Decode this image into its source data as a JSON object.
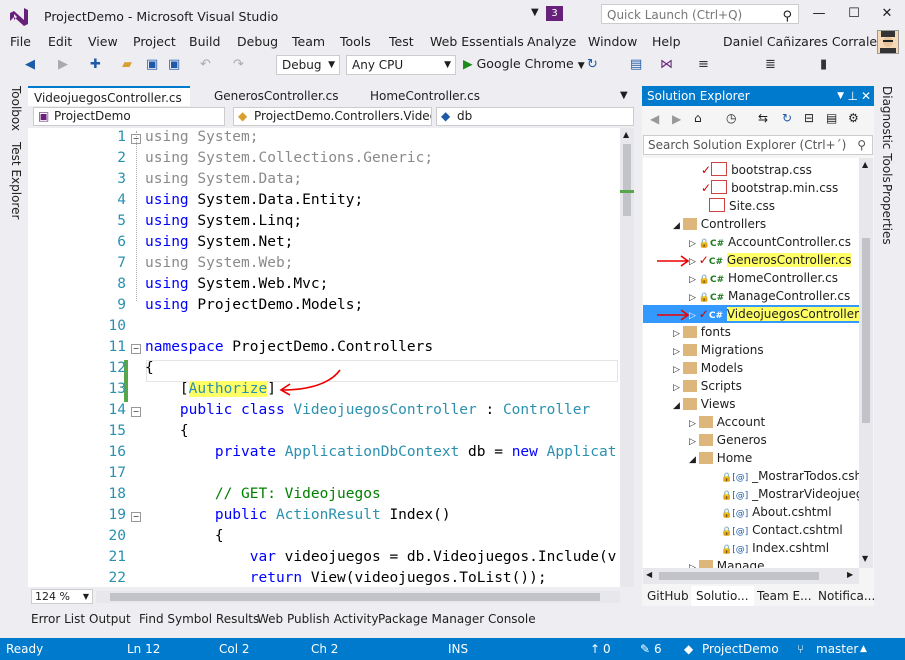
{
  "window": {
    "title": "ProjectDemo - Microsoft Visual Studio",
    "notification_count": "3",
    "quick_launch_placeholder": "Quick Launch (Ctrl+Q)",
    "user": "Daniel Cañizares Corrales"
  },
  "menu": [
    "File",
    "Edit",
    "View",
    "Project",
    "Build",
    "Debug",
    "Team",
    "Tools",
    "Test",
    "Web Essentials",
    "Analyze",
    "Window",
    "Help"
  ],
  "toolbar": {
    "config": "Debug",
    "platform": "Any CPU",
    "run_target": "Google Chrome"
  },
  "side_tabs_left": [
    "Toolbox",
    "Test Explorer"
  ],
  "side_tabs_right": [
    "Diagnostic Tools",
    "Properties"
  ],
  "doc_tabs": [
    "VideojuegosController.cs",
    "GenerosController.cs",
    "HomeController.cs"
  ],
  "nav": {
    "project": "ProjectDemo",
    "class": "ProjectDemo.Controllers.Video",
    "member": "db"
  },
  "code": {
    "line_numbers": [
      "1",
      "2",
      "3",
      "4",
      "5",
      "6",
      "7",
      "8",
      "9",
      "10",
      "11",
      "12",
      "13",
      "14",
      "15",
      "16",
      "17",
      "18",
      "19",
      "20",
      "21",
      "22"
    ],
    "l1_kw": "using",
    "l1_rest": " System;",
    "l2_kw": "using",
    "l2_rest": " System.Collections.Generic;",
    "l3_kw": "using",
    "l3_rest": " System.Data;",
    "l4_kw": "using",
    "l4_rest": " System.Data.Entity;",
    "l5_kw": "using",
    "l5_rest": " System.Linq;",
    "l6_kw": "using",
    "l6_rest": " System.Net;",
    "l7_kw": "using",
    "l7_rest": " System.Web;",
    "l8_kw": "using",
    "l8_rest": " System.Web.Mvc;",
    "l9_kw": "using",
    "l9_rest": " ProjectDemo.Models;",
    "l11_kw": "namespace",
    "l11_rest": " ProjectDemo.Controllers",
    "brace_open": "{",
    "l13_pre": "    [",
    "l13_attr": "Authorize",
    "l13_post": "]",
    "l14_kw": "    public class ",
    "l14_type": "VideojuegosController",
    "l14_mid": " : ",
    "l14_base": "Controller",
    "l15": "    {",
    "l16_kw": "        private ",
    "l16_type": "ApplicationDbContext",
    "l16_mid": " db = ",
    "l16_kw2": "new",
    "l16_type2": " Applicat",
    "l18": "        // GET: Videojuegos",
    "l19_kw": "        public ",
    "l19_type": "ActionResult",
    "l19_rest": " Index()",
    "l20": "        {",
    "l21_kw": "            var",
    "l21_rest": " videojuegos = db.Videojuegos.Include(v",
    "l22_kw": "            return",
    "l22_rest": " View(videojuegos.ToList());"
  },
  "zoom": "124 %",
  "solution_explorer": {
    "title": "Solution Explorer",
    "search_placeholder": "Search Solution Explorer (Ctrl+´)",
    "items": [
      "bootstrap.css",
      "bootstrap.min.css",
      "Site.css",
      "Controllers",
      "AccountController.cs",
      "GenerosController.cs",
      "HomeController.cs",
      "ManageController.cs",
      "VideojuegosController.cs",
      "fonts",
      "Migrations",
      "Models",
      "Scripts",
      "Views",
      "Account",
      "Generos",
      "Home",
      "_MostrarTodos.cshtr",
      "_MostrarVideojuego.",
      "About.cshtml",
      "Contact.cshtml",
      "Index.cshtml",
      "Manage"
    ],
    "bottom_tabs": [
      "GitHub",
      "Solutio...",
      "Team E...",
      "Notifica..."
    ]
  },
  "bottom_tabs": [
    "Error List",
    "Output",
    "Find Symbol Results",
    "Web Publish Activity",
    "Package Manager Console"
  ],
  "status": {
    "ready": "Ready",
    "ln": "Ln 12",
    "col": "Col 2",
    "ch": "Ch 2",
    "ins": "INS",
    "up": "0",
    "pencil": "6",
    "project": "ProjectDemo",
    "branch": "master"
  },
  "colors": {
    "accent": "#007acc",
    "vs_purple": "#68217a",
    "highlight": "#ffff66"
  }
}
